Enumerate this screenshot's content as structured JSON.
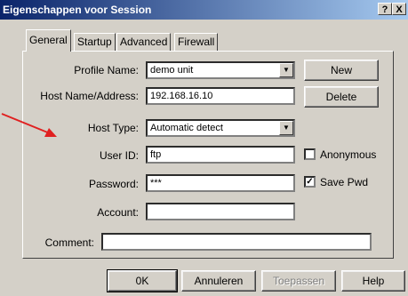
{
  "window": {
    "title": "Eigenschappen voor Session",
    "help_label": "?",
    "close_label": "X"
  },
  "tabs": [
    {
      "label": "General"
    },
    {
      "label": "Startup"
    },
    {
      "label": "Advanced"
    },
    {
      "label": "Firewall"
    }
  ],
  "form": {
    "profile_name_label": "Profile Name:",
    "profile_name_value": "demo unit",
    "host_label": "Host Name/Address:",
    "host_value": "192.168.16.10",
    "host_type_label": "Host Type:",
    "host_type_value": "Automatic detect",
    "user_id_label": "User ID:",
    "user_id_value": "ftp",
    "password_label": "Password:",
    "password_value": "***",
    "account_label": "Account:",
    "account_value": "",
    "comment_label": "Comment:",
    "comment_value": "",
    "anonymous_label": "Anonymous",
    "anonymous_checked": false,
    "save_pwd_label": "Save Pwd",
    "save_pwd_checked": true,
    "new_label": "New",
    "delete_label": "Delete"
  },
  "footer": {
    "ok_label": "0K",
    "cancel_label": "Annuleren",
    "apply_label": "Toepassen",
    "help_label": "Help"
  },
  "colors": {
    "dialog_bg": "#d4d0c8",
    "title_start": "#0a246a",
    "title_end": "#a6caf0",
    "arrow": "#e02020"
  },
  "icons": [
    "dropdown-arrow-icon",
    "checkmark-icon",
    "annotation-arrow-icon"
  ]
}
